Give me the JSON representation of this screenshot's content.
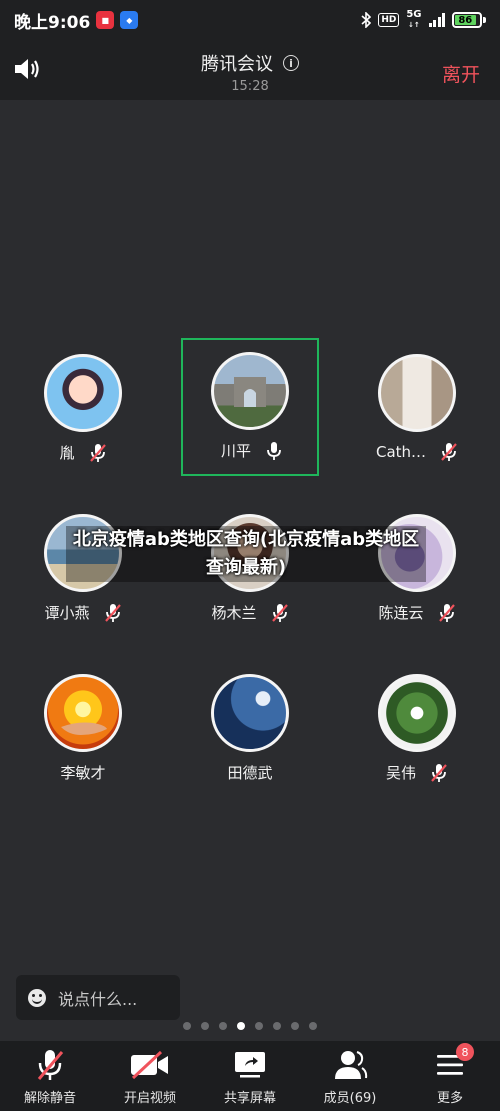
{
  "status_bar": {
    "time": "晚上9:06",
    "network": "5G",
    "hd": "HD",
    "battery": "86",
    "battery_level": 0.86
  },
  "header": {
    "title": "腾讯会议",
    "elapsed": "15:28",
    "leave_label": "离开",
    "speaker_icon": "speaker-icon",
    "info_icon": "info-icon"
  },
  "participants": [
    {
      "name": "胤",
      "mic": "muted",
      "avatar": "girl-photo"
    },
    {
      "name": "川平",
      "mic": "on",
      "avatar": "arch-photo",
      "active": true
    },
    {
      "name": "Cath…",
      "mic": "muted",
      "avatar": "dress-photo"
    },
    {
      "name": "谭小燕",
      "mic": "muted",
      "avatar": "beach-photo"
    },
    {
      "name": "杨木兰",
      "mic": "muted",
      "avatar": "woman-photo"
    },
    {
      "name": "陈连云",
      "mic": "muted",
      "avatar": "purple-flower-photo"
    },
    {
      "name": "李敏才",
      "mic": "none",
      "avatar": "sun-hand-photo"
    },
    {
      "name": "田德武",
      "mic": "none",
      "avatar": "moon-photo"
    },
    {
      "name": "吴伟",
      "mic": "muted",
      "avatar": "white-flower-photo"
    }
  ],
  "overlay_caption": "北京疫情ab类地区查询(北京疫情ab类地区查询最新)",
  "chat": {
    "placeholder": "说点什么..."
  },
  "pager": {
    "total": 8,
    "current": 4
  },
  "toolbar": {
    "items": [
      {
        "label": "解除静音",
        "icon": "mic-muted-icon"
      },
      {
        "label": "开启视频",
        "icon": "video-off-icon"
      },
      {
        "label": "共享屏幕",
        "icon": "share-screen-icon"
      },
      {
        "label": "成员(69)",
        "icon": "members-icon"
      },
      {
        "label": "更多",
        "icon": "more-icon",
        "badge": "8"
      }
    ]
  },
  "colors": {
    "background": "#2b2c2f",
    "bar": "#1f2022",
    "accent_red": "#f0535c",
    "active_border": "#1fb65b"
  }
}
